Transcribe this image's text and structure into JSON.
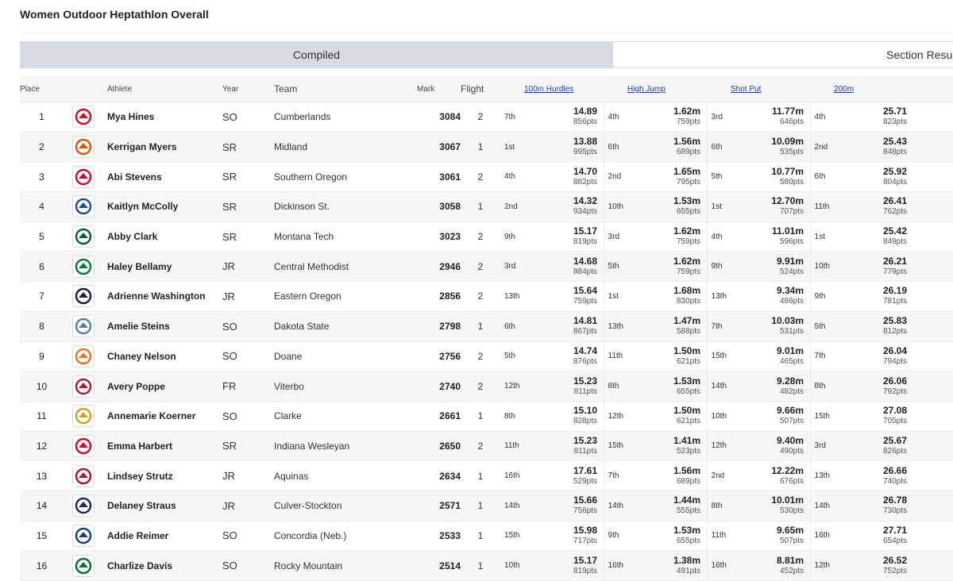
{
  "page": {
    "title": "Women Outdoor Heptathlon Overall"
  },
  "tabs": {
    "compiled": "Compiled",
    "section": "Section Results"
  },
  "headers": {
    "place": "Place",
    "athlete": "Athlete",
    "year": "Year",
    "team": "Team",
    "mark": "Mark",
    "flight": "Flight",
    "event1": "100m Hurdles",
    "event2": "High Jump",
    "event3": "Shot Put",
    "event4": "200m"
  },
  "rows": [
    {
      "place": "1",
      "athlete": "Mya Hines",
      "year": "SO",
      "team": "Cumberlands",
      "mark": "3084",
      "flight": "2",
      "logo": "cumberlands-logo-icon",
      "logo_color": "#c8102e",
      "e1": {
        "rank": "7th",
        "val": "14.89",
        "pts": "856pts"
      },
      "e2": {
        "rank": "4th",
        "val": "1.62m",
        "pts": "759pts"
      },
      "e3": {
        "rank": "3rd",
        "val": "11.77m",
        "pts": "646pts"
      },
      "e4": {
        "rank": "4th",
        "val": "25.71",
        "pts": "823pts"
      }
    },
    {
      "place": "2",
      "athlete": "Kerrigan Myers",
      "year": "SR",
      "team": "Midland",
      "mark": "3067",
      "flight": "1",
      "logo": "midland-logo-icon",
      "logo_color": "#e35205",
      "e1": {
        "rank": "1st",
        "val": "13.88",
        "pts": "995pts"
      },
      "e2": {
        "rank": "6th",
        "val": "1.56m",
        "pts": "689pts"
      },
      "e3": {
        "rank": "6th",
        "val": "10.09m",
        "pts": "535pts"
      },
      "e4": {
        "rank": "2nd",
        "val": "25.43",
        "pts": "848pts"
      }
    },
    {
      "place": "3",
      "athlete": "Abi Stevens",
      "year": "SR",
      "team": "Southern Oregon",
      "mark": "3061",
      "flight": "2",
      "logo": "southern-oregon-logo-icon",
      "logo_color": "#c8102e",
      "e1": {
        "rank": "4th",
        "val": "14.70",
        "pts": "882pts"
      },
      "e2": {
        "rank": "2nd",
        "val": "1.65m",
        "pts": "795pts"
      },
      "e3": {
        "rank": "5th",
        "val": "10.77m",
        "pts": "580pts"
      },
      "e4": {
        "rank": "6th",
        "val": "25.92",
        "pts": "804pts"
      }
    },
    {
      "place": "4",
      "athlete": "Kaitlyn McColly",
      "year": "SR",
      "team": "Dickinson St.",
      "mark": "3058",
      "flight": "1",
      "logo": "dickinson-state-logo-icon",
      "logo_color": "#1f4e9c",
      "e1": {
        "rank": "2nd",
        "val": "14.32",
        "pts": "934pts"
      },
      "e2": {
        "rank": "10th",
        "val": "1.53m",
        "pts": "655pts"
      },
      "e3": {
        "rank": "1st",
        "val": "12.70m",
        "pts": "707pts"
      },
      "e4": {
        "rank": "11th",
        "val": "26.41",
        "pts": "762pts"
      }
    },
    {
      "place": "5",
      "athlete": "Abby Clark",
      "year": "SR",
      "team": "Montana Tech",
      "mark": "3023",
      "flight": "2",
      "logo": "montana-tech-logo-icon",
      "logo_color": "#0b5d3b",
      "e1": {
        "rank": "9th",
        "val": "15.17",
        "pts": "819pts"
      },
      "e2": {
        "rank": "3rd",
        "val": "1.62m",
        "pts": "759pts"
      },
      "e3": {
        "rank": "4th",
        "val": "11.01m",
        "pts": "596pts"
      },
      "e4": {
        "rank": "1st",
        "val": "25.42",
        "pts": "849pts"
      }
    },
    {
      "place": "6",
      "athlete": "Haley Bellamy",
      "year": "JR",
      "team": "Central Methodist",
      "mark": "2946",
      "flight": "2",
      "logo": "central-methodist-logo-icon",
      "logo_color": "#0a7a3c",
      "e1": {
        "rank": "3rd",
        "val": "14.68",
        "pts": "884pts"
      },
      "e2": {
        "rank": "5th",
        "val": "1.62m",
        "pts": "759pts"
      },
      "e3": {
        "rank": "9th",
        "val": "9.91m",
        "pts": "524pts"
      },
      "e4": {
        "rank": "10th",
        "val": "26.21",
        "pts": "779pts"
      }
    },
    {
      "place": "7",
      "athlete": "Adrienne Washington",
      "year": "JR",
      "team": "Eastern Oregon",
      "mark": "2856",
      "flight": "2",
      "logo": "eastern-oregon-logo-icon",
      "logo_color": "#1b1f3b",
      "e1": {
        "rank": "13th",
        "val": "15.64",
        "pts": "759pts"
      },
      "e2": {
        "rank": "1st",
        "val": "1.68m",
        "pts": "830pts"
      },
      "e3": {
        "rank": "13th",
        "val": "9.34m",
        "pts": "486pts"
      },
      "e4": {
        "rank": "9th",
        "val": "26.19",
        "pts": "781pts"
      }
    },
    {
      "place": "8",
      "athlete": "Amelie Steins",
      "year": "SO",
      "team": "Dakota State",
      "mark": "2798",
      "flight": "1",
      "logo": "dakota-state-logo-icon",
      "logo_color": "#5b7fa6",
      "e1": {
        "rank": "6th",
        "val": "14.81",
        "pts": "867pts"
      },
      "e2": {
        "rank": "13th",
        "val": "1.47m",
        "pts": "588pts"
      },
      "e3": {
        "rank": "7th",
        "val": "10.03m",
        "pts": "531pts"
      },
      "e4": {
        "rank": "5th",
        "val": "25.83",
        "pts": "812pts"
      }
    },
    {
      "place": "9",
      "athlete": "Chaney Nelson",
      "year": "SO",
      "team": "Doane",
      "mark": "2756",
      "flight": "2",
      "logo": "doane-logo-icon",
      "logo_color": "#e87722",
      "e1": {
        "rank": "5th",
        "val": "14.74",
        "pts": "876pts"
      },
      "e2": {
        "rank": "11th",
        "val": "1.50m",
        "pts": "621pts"
      },
      "e3": {
        "rank": "15th",
        "val": "9.01m",
        "pts": "465pts"
      },
      "e4": {
        "rank": "7th",
        "val": "26.04",
        "pts": "794pts"
      }
    },
    {
      "place": "10",
      "athlete": "Avery Poppe",
      "year": "FR",
      "team": "Viterbo",
      "mark": "2740",
      "flight": "2",
      "logo": "viterbo-logo-icon",
      "logo_color": "#b31b34",
      "e1": {
        "rank": "12th",
        "val": "15.23",
        "pts": "811pts"
      },
      "e2": {
        "rank": "8th",
        "val": "1.53m",
        "pts": "655pts"
      },
      "e3": {
        "rank": "14th",
        "val": "9.28m",
        "pts": "482pts"
      },
      "e4": {
        "rank": "8th",
        "val": "26.06",
        "pts": "792pts"
      }
    },
    {
      "place": "11",
      "athlete": "Annemarie Koerner",
      "year": "SO",
      "team": "Clarke",
      "mark": "2661",
      "flight": "1",
      "logo": "clarke-logo-icon",
      "logo_color": "#c9a227",
      "e1": {
        "rank": "8th",
        "val": "15.10",
        "pts": "828pts"
      },
      "e2": {
        "rank": "12th",
        "val": "1.50m",
        "pts": "621pts"
      },
      "e3": {
        "rank": "10th",
        "val": "9.66m",
        "pts": "507pts"
      },
      "e4": {
        "rank": "15th",
        "val": "27.08",
        "pts": "705pts"
      }
    },
    {
      "place": "12",
      "athlete": "Emma Harbert",
      "year": "SR",
      "team": "Indiana Wesleyan",
      "mark": "2650",
      "flight": "2",
      "logo": "indiana-wesleyan-logo-icon",
      "logo_color": "#c8102e",
      "e1": {
        "rank": "11th",
        "val": "15.23",
        "pts": "811pts"
      },
      "e2": {
        "rank": "15th",
        "val": "1.41m",
        "pts": "523pts"
      },
      "e3": {
        "rank": "12th",
        "val": "9.40m",
        "pts": "490pts"
      },
      "e4": {
        "rank": "3rd",
        "val": "25.67",
        "pts": "826pts"
      }
    },
    {
      "place": "13",
      "athlete": "Lindsey Strutz",
      "year": "JR",
      "team": "Aquinas",
      "mark": "2634",
      "flight": "1",
      "logo": "aquinas-logo-icon",
      "logo_color": "#a6192e",
      "e1": {
        "rank": "16th",
        "val": "17.61",
        "pts": "529pts"
      },
      "e2": {
        "rank": "7th",
        "val": "1.56m",
        "pts": "689pts"
      },
      "e3": {
        "rank": "2nd",
        "val": "12.22m",
        "pts": "676pts"
      },
      "e4": {
        "rank": "13th",
        "val": "26.66",
        "pts": "740pts"
      }
    },
    {
      "place": "14",
      "athlete": "Delaney Straus",
      "year": "JR",
      "team": "Culver-Stockton",
      "mark": "2571",
      "flight": "1",
      "logo": "culver-stockton-logo-icon",
      "logo_color": "#1c2b5a",
      "e1": {
        "rank": "14th",
        "val": "15.66",
        "pts": "756pts"
      },
      "e2": {
        "rank": "14th",
        "val": "1.44m",
        "pts": "555pts"
      },
      "e3": {
        "rank": "8th",
        "val": "10.01m",
        "pts": "530pts"
      },
      "e4": {
        "rank": "14th",
        "val": "26.78",
        "pts": "730pts"
      }
    },
    {
      "place": "15",
      "athlete": "Addie Reimer",
      "year": "SO",
      "team": "Concordia (Neb.)",
      "mark": "2533",
      "flight": "1",
      "logo": "concordia-logo-icon",
      "logo_color": "#1c3f7a",
      "e1": {
        "rank": "15th",
        "val": "15.98",
        "pts": "717pts"
      },
      "e2": {
        "rank": "9th",
        "val": "1.53m",
        "pts": "655pts"
      },
      "e3": {
        "rank": "11th",
        "val": "9.65m",
        "pts": "507pts"
      },
      "e4": {
        "rank": "16th",
        "val": "27.71",
        "pts": "654pts"
      }
    },
    {
      "place": "16",
      "athlete": "Charlize Davis",
      "year": "SO",
      "team": "Rocky Mountain",
      "mark": "2514",
      "flight": "1",
      "logo": "rocky-mountain-logo-icon",
      "logo_color": "#0b6b3a",
      "e1": {
        "rank": "10th",
        "val": "15.17",
        "pts": "819pts"
      },
      "e2": {
        "rank": "16th",
        "val": "1.38m",
        "pts": "491pts"
      },
      "e3": {
        "rank": "16th",
        "val": "8.81m",
        "pts": "452pts"
      },
      "e4": {
        "rank": "12th",
        "val": "26.52",
        "pts": "752pts"
      }
    }
  ]
}
